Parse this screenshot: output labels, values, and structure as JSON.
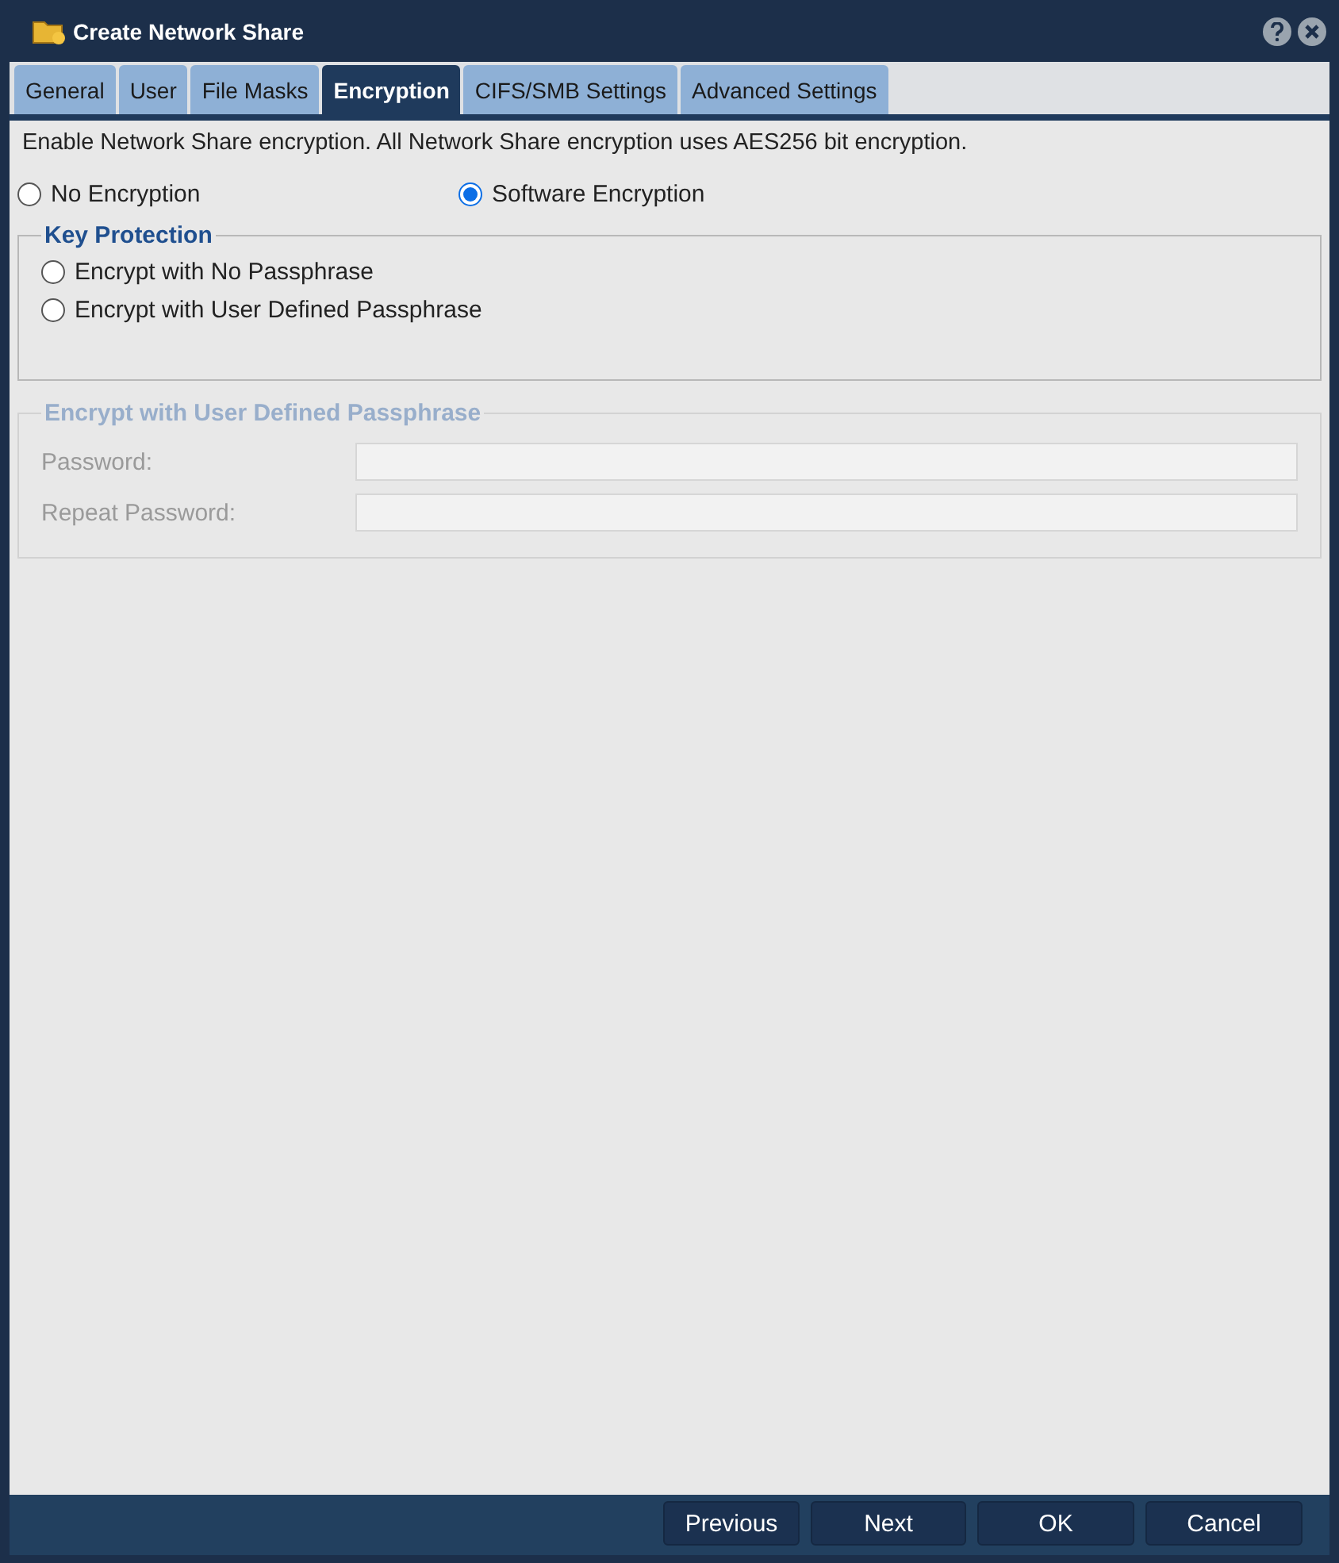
{
  "window": {
    "title": "Create Network Share"
  },
  "tabs": [
    {
      "label": "General",
      "selected": false
    },
    {
      "label": "User",
      "selected": false
    },
    {
      "label": "File Masks",
      "selected": false
    },
    {
      "label": "Encryption",
      "selected": true
    },
    {
      "label": "CIFS/SMB Settings",
      "selected": false
    },
    {
      "label": "Advanced Settings",
      "selected": false
    }
  ],
  "description": "Enable Network Share encryption. All Network Share encryption uses AES256 bit encryption.",
  "encryption_options": [
    {
      "label": "No Encryption",
      "selected": false
    },
    {
      "label": "Software Encryption",
      "selected": true
    }
  ],
  "key_protection": {
    "title": "Key Protection",
    "options": [
      {
        "label": "Encrypt with No Passphrase",
        "selected": false
      },
      {
        "label": "Encrypt with User Defined Passphrase",
        "selected": false
      }
    ]
  },
  "passphrase_group": {
    "title": "Encrypt with User Defined Passphrase",
    "disabled": true,
    "fields": [
      {
        "label": "Password:"
      },
      {
        "label": "Repeat Password:"
      }
    ]
  },
  "buttons": [
    "Previous",
    "Next",
    "OK",
    "Cancel"
  ]
}
